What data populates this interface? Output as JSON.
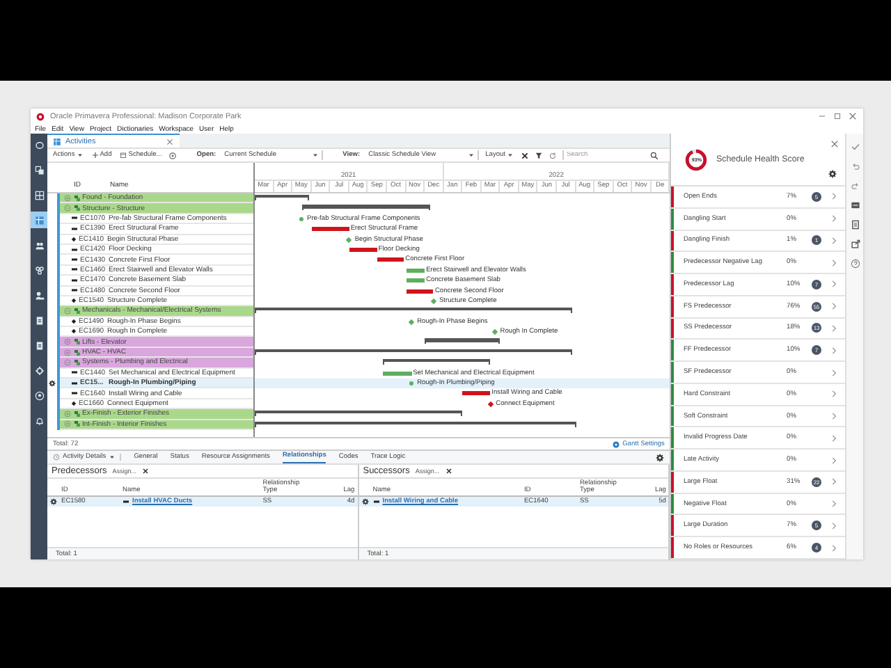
{
  "window": {
    "title": "Oracle Primavera Professional: Madison Corporate Park"
  },
  "menu": [
    "File",
    "Edit",
    "View",
    "Project",
    "Dictionaries",
    "Workspace",
    "User",
    "Help"
  ],
  "doc_tab": {
    "label": "Activities"
  },
  "toolbar": {
    "actions": "Actions",
    "add": "Add",
    "schedule": "Schedule...",
    "open_label": "Open:",
    "open_value": "Current Schedule",
    "view_label": "View:",
    "view_value": "Classic Schedule View",
    "layout": "Layout",
    "search": {
      "placeholder": "Search"
    }
  },
  "table": {
    "columns": [
      "ID",
      "Name"
    ],
    "rows": [
      {
        "kind": "group",
        "name": "Found - Foundation",
        "expanded": false,
        "color": "#a9d88a",
        "selected": false
      },
      {
        "kind": "group",
        "name": "Structure - Structure",
        "expanded": true,
        "color": "#a9d88a",
        "selected": false
      },
      {
        "kind": "task",
        "id": "EC1070",
        "name": "Pre-fab Structural Frame Components",
        "selected": false,
        "bar": {
          "critical": false,
          "label": "Pre-fab Structural Frame Components"
        }
      },
      {
        "kind": "task",
        "id": "EC1390",
        "name": "Erect Structural Frame",
        "selected": false,
        "bar": {
          "critical": true,
          "label": "Erect Structural Frame"
        }
      },
      {
        "kind": "milestone",
        "id": "EC1410",
        "name": "Begin Structural Phase",
        "selected": false,
        "bar": {
          "critical": false,
          "label": "Begin Structural Phase"
        }
      },
      {
        "kind": "task",
        "id": "EC1420",
        "name": "Floor Decking",
        "selected": false,
        "bar": {
          "critical": true,
          "label": "Floor Decking"
        }
      },
      {
        "kind": "task",
        "id": "EC1430",
        "name": "Concrete First Floor",
        "selected": false,
        "bar": {
          "critical": true,
          "label": "Concrete First Floor"
        }
      },
      {
        "kind": "task",
        "id": "EC1460",
        "name": "Erect Stairwell and Elevator Walls",
        "selected": false,
        "bar": {
          "critical": false,
          "label": "Erect Stairwell and Elevator Walls"
        }
      },
      {
        "kind": "task",
        "id": "EC1470",
        "name": "Concrete Basement Slab",
        "selected": false,
        "bar": {
          "critical": false,
          "label": "Concrete Basement Slab"
        }
      },
      {
        "kind": "task",
        "id": "EC1480",
        "name": "Concrete Second Floor",
        "selected": false,
        "bar": {
          "critical": true,
          "label": "Concrete Second Floor"
        }
      },
      {
        "kind": "milestone",
        "id": "EC1540",
        "name": "Structure Complete",
        "selected": false,
        "bar": {
          "critical": false,
          "label": "Structure Complete"
        }
      },
      {
        "kind": "group",
        "name": "Mechanicals - Mechanical/Electrical Systems",
        "expanded": true,
        "color": "#a9d88a",
        "selected": false
      },
      {
        "kind": "milestone",
        "id": "EC1490",
        "name": "Rough-In Phase Begins",
        "selected": false,
        "bar": {
          "critical": false,
          "label": "Rough-In Phase Begins"
        }
      },
      {
        "kind": "milestone",
        "id": "EC1690",
        "name": "Rough In Complete",
        "selected": false,
        "bar": {
          "critical": false,
          "label": "Rough In Complete"
        }
      },
      {
        "kind": "group",
        "name": "Lifts - Elevator",
        "expanded": false,
        "color": "#d9a6dd",
        "selected": false
      },
      {
        "kind": "group",
        "name": "HVAC - HVAC",
        "expanded": false,
        "color": "#d9a6dd",
        "selected": false
      },
      {
        "kind": "group",
        "name": "Systems - Plumbing and Electrical",
        "expanded": true,
        "color": "#d9a6dd",
        "selected": false
      },
      {
        "kind": "task",
        "id": "EC1440",
        "name": "Set Mechanical and Electrical Equipment",
        "selected": false,
        "bar": {
          "critical": false,
          "label": "Set Mechanical and Electrical Equipment"
        }
      },
      {
        "kind": "task",
        "id": "EC15...",
        "name": "Rough-In Plumbing/Piping",
        "selected": true,
        "bar": {
          "critical": false,
          "label": "Rough-In Plumbing/Piping"
        }
      },
      {
        "kind": "task",
        "id": "EC1640",
        "name": "Install Wiring and Cable",
        "selected": false,
        "bar": {
          "critical": true,
          "label": "Install Wiring and Cable"
        }
      },
      {
        "kind": "milestone",
        "id": "EC1660",
        "name": "Connect Equipment",
        "selected": false,
        "bar": {
          "critical": true,
          "label": "Connect Equipment"
        }
      },
      {
        "kind": "group",
        "name": "Ex-Finish - Exterior Finishes",
        "expanded": false,
        "color": "#a9d88a",
        "selected": false
      },
      {
        "kind": "group",
        "name": "Int-Finish - Interior Finishes",
        "expanded": false,
        "color": "#a9d88a",
        "selected": false
      }
    ],
    "total": "Total: 72"
  },
  "timescale": {
    "years": [
      "2021",
      "2022"
    ],
    "months": [
      "Mar",
      "Apr",
      "May",
      "Jun",
      "Jul",
      "Aug",
      "Sep",
      "Oct",
      "Nov",
      "Dec",
      "Jan",
      "Feb",
      "Mar",
      "Apr",
      "May",
      "Jun",
      "Jul",
      "Aug",
      "Sep",
      "Oct",
      "Nov",
      "De"
    ]
  },
  "gantt_settings": "Gantt Settings",
  "details": {
    "menu": "Activity Details",
    "tabs": [
      {
        "label": "General",
        "selected": false
      },
      {
        "label": "Status",
        "selected": false
      },
      {
        "label": "Resource Assignments",
        "selected": false
      },
      {
        "label": "Relationships",
        "selected": true
      },
      {
        "label": "Codes",
        "selected": false
      },
      {
        "label": "Trace Logic",
        "selected": false
      }
    ],
    "panes": [
      {
        "kind": "predecessors",
        "title": "Predecessors",
        "assign": "Assign...",
        "columns": [
          {
            "label": "ID",
            "kind": "text"
          },
          {
            "label": "Name",
            "kind": "link"
          },
          {
            "label": "Relationship Type",
            "kind": "text"
          },
          {
            "label": "Lag",
            "kind": "number"
          }
        ],
        "rows": [
          {
            "selected": true,
            "cells": [
              "EC1580",
              "Install HVAC Ducts",
              "SS",
              "4d"
            ]
          }
        ],
        "total": "Total: 1"
      },
      {
        "kind": "successors",
        "title": "Successors",
        "assign": "Assign...",
        "columns": [
          {
            "label": "Name",
            "kind": "link"
          },
          {
            "label": "ID",
            "kind": "text"
          },
          {
            "label": "Relationship Type",
            "kind": "text"
          },
          {
            "label": "Lag",
            "kind": "number"
          }
        ],
        "rows": [
          {
            "selected": true,
            "cells": [
              "Install Wiring and Cable",
              "EC1640",
              "SS",
              "5d"
            ]
          }
        ],
        "total": "Total: 1"
      }
    ]
  },
  "health": {
    "title": "Schedule Health Score",
    "score": "93%",
    "level": 0.93,
    "items": [
      {
        "label": "Open Ends",
        "percent": "7%",
        "count": "5",
        "color": "#c8102e"
      },
      {
        "label": "Dangling Start",
        "percent": "0%",
        "color": "#2e8b3e"
      },
      {
        "label": "Dangling Finish",
        "percent": "1%",
        "count": "1",
        "color": "#c8102e"
      },
      {
        "label": "Predecessor Negative Lag",
        "percent": "0%",
        "color": "#2e8b3e"
      },
      {
        "label": "Predecessor Lag",
        "percent": "10%",
        "count": "7",
        "color": "#c8102e"
      },
      {
        "label": "FS Predecessor",
        "percent": "76%",
        "count": "55",
        "color": "#c8102e"
      },
      {
        "label": "SS Predecessor",
        "percent": "18%",
        "count": "13",
        "color": "#c8102e"
      },
      {
        "label": "FF Predecessor",
        "percent": "10%",
        "count": "7",
        "color": "#2e8b3e"
      },
      {
        "label": "SF Predecessor",
        "percent": "0%",
        "color": "#2e8b3e"
      },
      {
        "label": "Hard Constraint",
        "percent": "0%",
        "color": "#2e8b3e"
      },
      {
        "label": "Soft Constraint",
        "percent": "0%",
        "color": "#2e8b3e"
      },
      {
        "label": "Invalid Progress Date",
        "percent": "0%",
        "color": "#2e8b3e"
      },
      {
        "label": "Late Activity",
        "percent": "0%",
        "color": "#2e8b3e"
      },
      {
        "label": "Large Float",
        "percent": "31%",
        "count": "22",
        "color": "#c8102e"
      },
      {
        "label": "Negative Float",
        "percent": "0%",
        "color": "#2e8b3e"
      },
      {
        "label": "Large Duration",
        "percent": "7%",
        "count": "5",
        "color": "#c8102e"
      },
      {
        "label": "No Roles or Resources",
        "percent": "6%",
        "count": "4",
        "color": "#c8102e"
      }
    ]
  }
}
